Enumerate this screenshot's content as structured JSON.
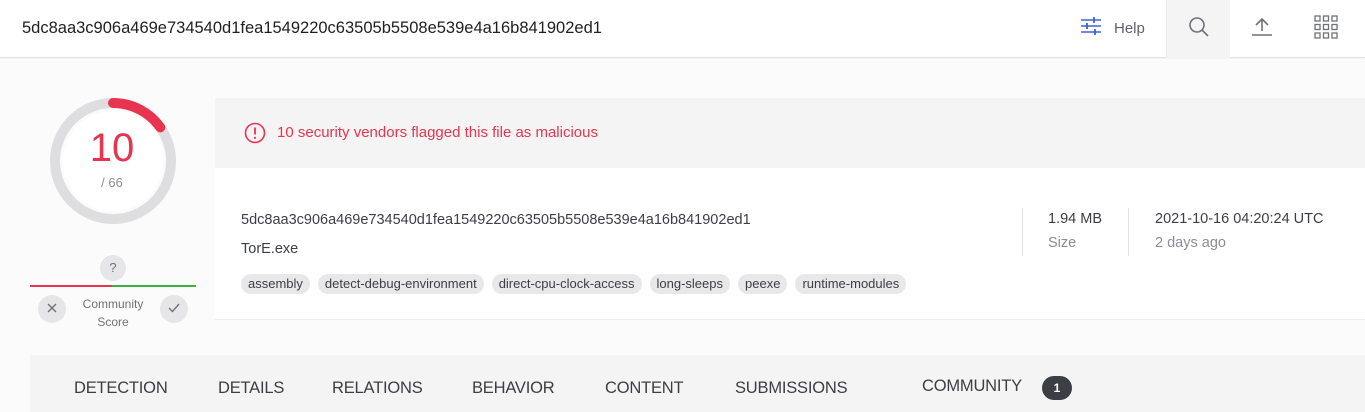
{
  "search": {
    "value": "5dc8aa3c906a469e734540d1fea1549220c63505b5508e539e4a16b841902ed1"
  },
  "toolbar": {
    "help_label": "Help",
    "icons": [
      "filter-sliders-icon",
      "search-icon",
      "upload-icon",
      "apps-grid-icon"
    ]
  },
  "score": {
    "detections": "10",
    "total": "/ 66",
    "detection_ratio": 0.1515,
    "accent_color": "#e8344e"
  },
  "community": {
    "unknown_mark": "?",
    "label_line1": "Community",
    "label_line2": "Score",
    "vote_down_icon": "x-icon",
    "vote_up_icon": "check-icon"
  },
  "alert": {
    "text": "10 security vendors flagged this file as malicious",
    "color": "#e8344e"
  },
  "file": {
    "hash": "5dc8aa3c906a469e734540d1fea1549220c63505b5508e539e4a16b841902ed1",
    "name": "TorE.exe",
    "tags": [
      "assembly",
      "detect-debug-environment",
      "direct-cpu-clock-access",
      "long-sleeps",
      "peexe",
      "runtime-modules"
    ],
    "size_value": "1.94 MB",
    "size_label": "Size",
    "date_value": "2021-10-16 04:20:24 UTC",
    "date_relative": "2 days ago"
  },
  "tabs": [
    {
      "label": "DETECTION"
    },
    {
      "label": "DETAILS"
    },
    {
      "label": "RELATIONS"
    },
    {
      "label": "BEHAVIOR"
    },
    {
      "label": "CONTENT"
    },
    {
      "label": "SUBMISSIONS"
    },
    {
      "label": "COMMUNITY",
      "badge": "1"
    }
  ]
}
